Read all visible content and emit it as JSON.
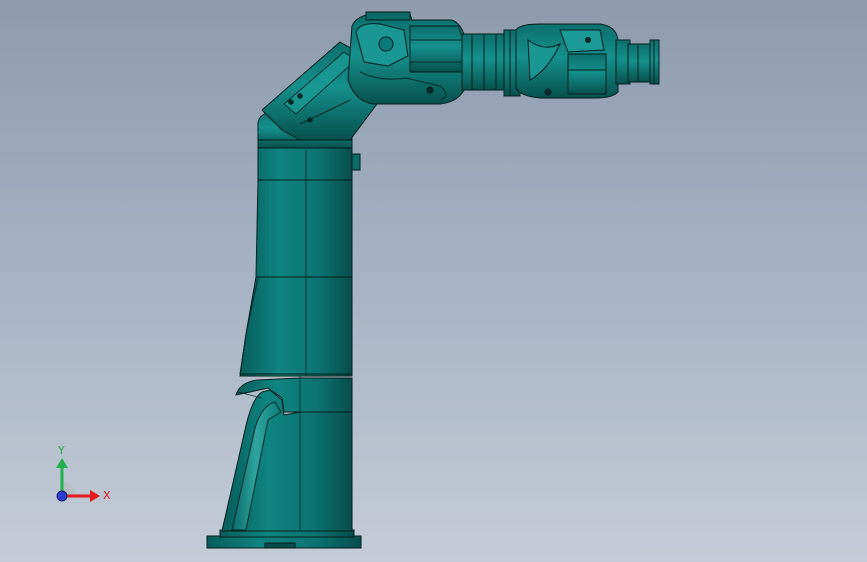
{
  "triad": {
    "x_label": "X",
    "y_label": "Y"
  },
  "colors": {
    "model_main": "#0c7a78",
    "model_light": "#2fa9a4",
    "model_dark": "#064f4d",
    "edge": "#031f1f",
    "bg_top": "#8d9bad",
    "bg_bottom": "#c4ccd8",
    "axis_x": "#e8191c",
    "axis_y": "#22b14c",
    "axis_z": "#2d3fd1"
  }
}
